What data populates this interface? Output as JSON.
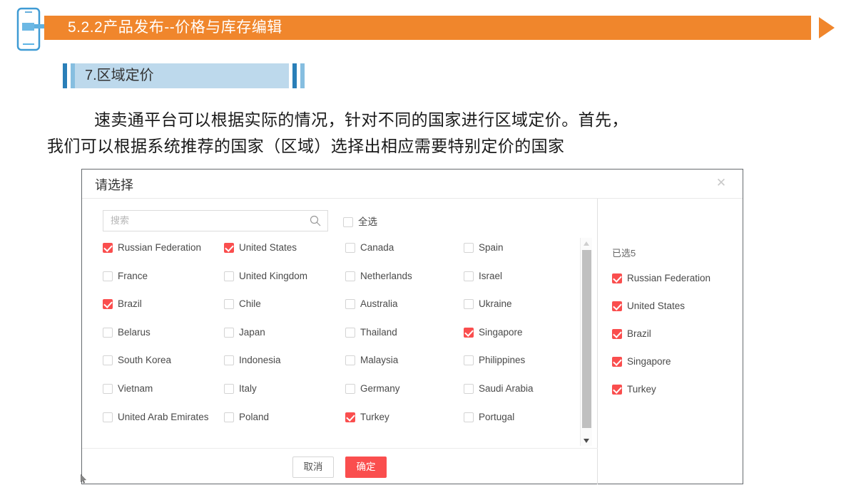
{
  "slide": {
    "banner_title": "5.2.2产品发布--价格与库存编辑",
    "section_title": "7.区域定价",
    "body_line1": "速卖通平台可以根据实际的情况，针对不同的国家进行区域定价。首先，",
    "body_line2": "我们可以根据系统推荐的国家（区域）选择出相应需要特别定价的国家",
    "colors": {
      "banner": "#f0862c",
      "section_band": "#bdd9ec",
      "bar_dark": "#2a7fb8",
      "bar_light": "#86bee0",
      "accent_red": "#fa4e4e"
    },
    "icons": {
      "phone": "phone-icon",
      "arrow": "play-triangle-icon"
    }
  },
  "dialog": {
    "title": "请选择",
    "close_icon": "close-icon",
    "search": {
      "placeholder": "搜索",
      "value": "",
      "icon": "search-icon"
    },
    "select_all": {
      "label": "全选",
      "checked": false
    },
    "countries": [
      {
        "label": "Russian Federation",
        "checked": true
      },
      {
        "label": "United States",
        "checked": true
      },
      {
        "label": "Canada",
        "checked": false
      },
      {
        "label": "Spain",
        "checked": false
      },
      {
        "label": "France",
        "checked": false
      },
      {
        "label": "United Kingdom",
        "checked": false
      },
      {
        "label": "Netherlands",
        "checked": false
      },
      {
        "label": "Israel",
        "checked": false
      },
      {
        "label": "Brazil",
        "checked": true
      },
      {
        "label": "Chile",
        "checked": false
      },
      {
        "label": "Australia",
        "checked": false
      },
      {
        "label": "Ukraine",
        "checked": false
      },
      {
        "label": "Belarus",
        "checked": false
      },
      {
        "label": "Japan",
        "checked": false
      },
      {
        "label": "Thailand",
        "checked": false
      },
      {
        "label": "Singapore",
        "checked": true
      },
      {
        "label": "South Korea",
        "checked": false
      },
      {
        "label": "Indonesia",
        "checked": false
      },
      {
        "label": "Malaysia",
        "checked": false
      },
      {
        "label": "Philippines",
        "checked": false
      },
      {
        "label": "Vietnam",
        "checked": false
      },
      {
        "label": "Italy",
        "checked": false
      },
      {
        "label": "Germany",
        "checked": false
      },
      {
        "label": "Saudi Arabia",
        "checked": false
      },
      {
        "label": "United Arab Emirates",
        "checked": false
      },
      {
        "label": "Poland",
        "checked": false
      },
      {
        "label": "Turkey",
        "checked": true
      },
      {
        "label": "Portugal",
        "checked": false
      }
    ],
    "selected_panel": {
      "count_label": "已选5",
      "items": [
        {
          "label": "Russian Federation",
          "checked": true
        },
        {
          "label": "United States",
          "checked": true
        },
        {
          "label": "Brazil",
          "checked": true
        },
        {
          "label": "Singapore",
          "checked": true
        },
        {
          "label": "Turkey",
          "checked": true
        }
      ]
    },
    "footer": {
      "cancel_label": "取消",
      "confirm_label": "确定"
    },
    "scrollbar": {
      "up_icon": "chevron-up-icon",
      "down_icon": "chevron-down-icon"
    }
  }
}
